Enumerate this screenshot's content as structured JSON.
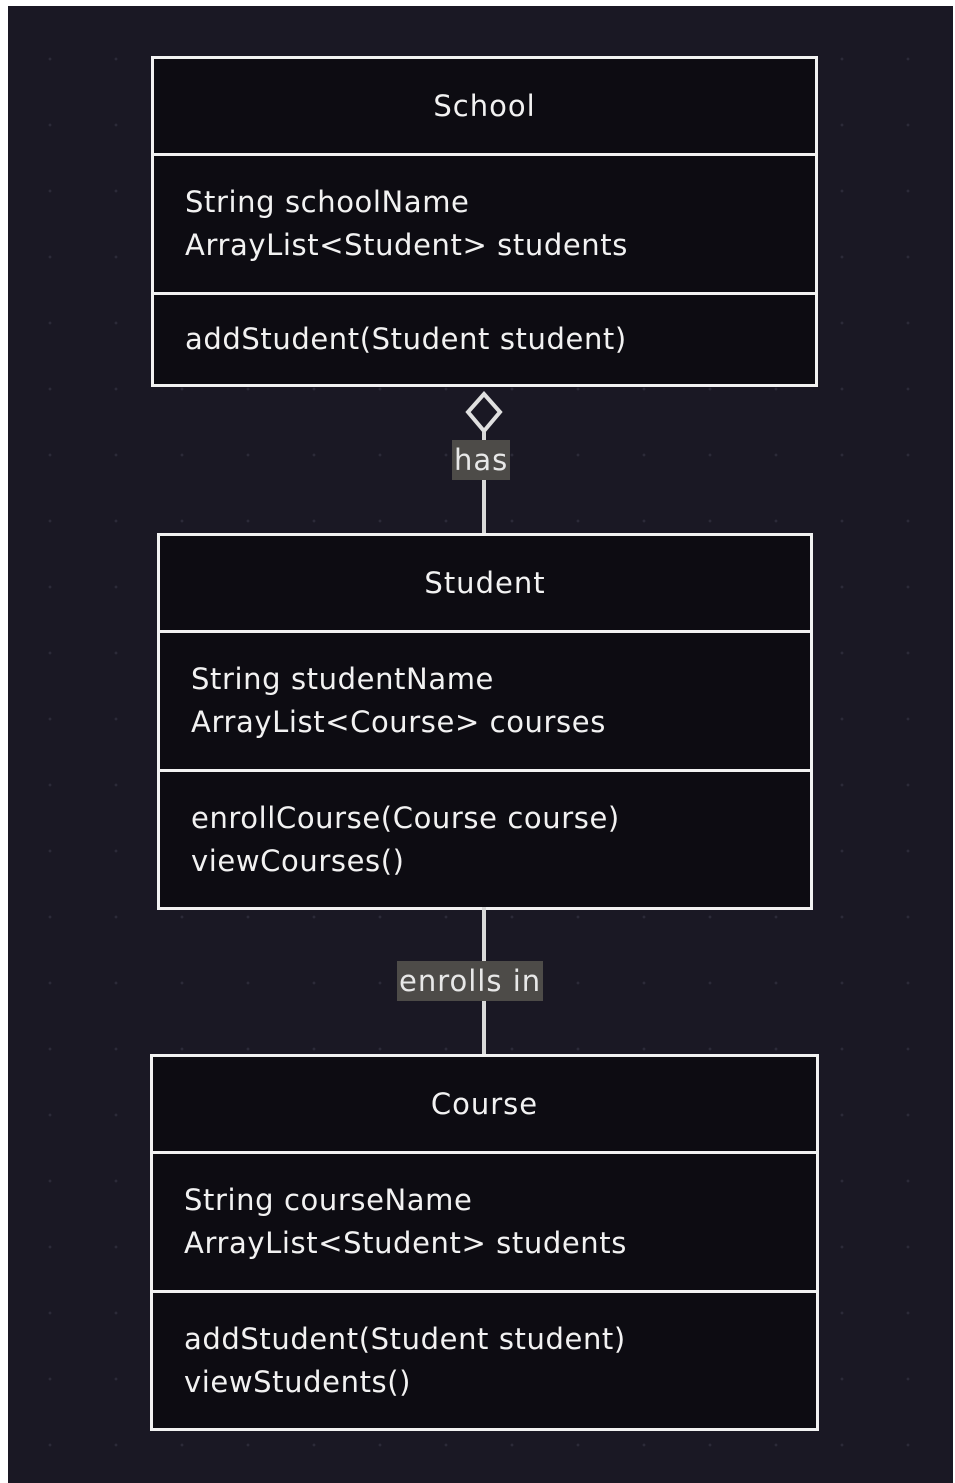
{
  "classes": {
    "school": {
      "name": "School",
      "attributes": [
        "String schoolName",
        "ArrayList<Student> students"
      ],
      "methods": [
        "addStudent(Student student)"
      ]
    },
    "student": {
      "name": "Student",
      "attributes": [
        "String studentName",
        "ArrayList<Course> courses"
      ],
      "methods": [
        "enrollCourse(Course course)",
        "viewCourses()"
      ]
    },
    "course": {
      "name": "Course",
      "attributes": [
        "String courseName",
        "ArrayList<Student> students"
      ],
      "methods": [
        "addStudent(Student student)",
        "viewStudents()"
      ]
    }
  },
  "relations": {
    "school_student": {
      "label": "has",
      "type": "aggregation"
    },
    "student_course": {
      "label": "enrolls in",
      "type": "association"
    }
  },
  "colors": {
    "background": "#1a1824",
    "box_fill": "#0d0c12",
    "stroke": "#f2f2f2",
    "label_bg": "#4d4b48"
  }
}
